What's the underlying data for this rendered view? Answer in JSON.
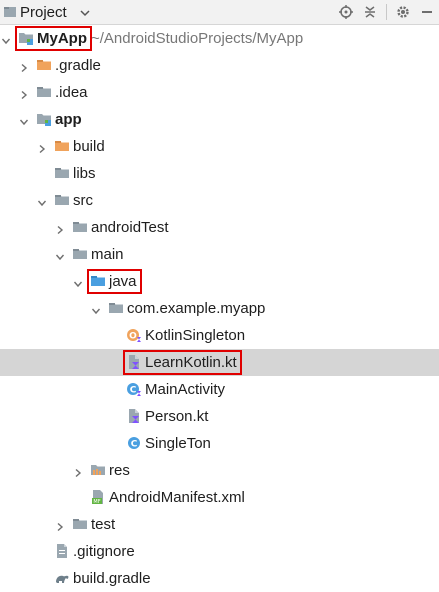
{
  "toolbar": {
    "title": "Project",
    "actions": [
      {
        "name": "locate-icon"
      },
      {
        "name": "collapse-all-icon"
      },
      {
        "name": "gear-icon"
      },
      {
        "name": "hide-icon"
      }
    ]
  },
  "tree": [
    {
      "label": "MyApp",
      "path": "~/AndroidStudioProjects/MyApp",
      "icon": "module-folder-icon",
      "arrow": "down",
      "bold": true,
      "highlight": true
    },
    {
      "label": ".gradle",
      "icon": "folder-orange-icon",
      "arrow": "right"
    },
    {
      "label": ".idea",
      "icon": "folder-gray-icon",
      "arrow": "right"
    },
    {
      "label": "app",
      "icon": "module-folder-icon",
      "arrow": "down",
      "bold": true
    },
    {
      "label": "build",
      "icon": "folder-orange-icon",
      "arrow": "right"
    },
    {
      "label": "libs",
      "icon": "folder-gray-icon",
      "arrow": "none"
    },
    {
      "label": "src",
      "icon": "folder-gray-icon",
      "arrow": "down"
    },
    {
      "label": "androidTest",
      "icon": "folder-gray-icon",
      "arrow": "right"
    },
    {
      "label": "main",
      "icon": "folder-gray-icon",
      "arrow": "down"
    },
    {
      "label": "java",
      "icon": "folder-blue-icon",
      "arrow": "down",
      "highlight": true
    },
    {
      "label": "com.example.myapp",
      "icon": "folder-gray-icon",
      "arrow": "down"
    },
    {
      "label": "KotlinSingleton",
      "icon": "kotlin-object-icon",
      "arrow": "none"
    },
    {
      "label": "LearnKotlin.kt",
      "icon": "kotlin-file-icon",
      "arrow": "none",
      "selected": true,
      "highlight": true
    },
    {
      "label": "MainActivity",
      "icon": "kotlin-class-icon",
      "arrow": "none"
    },
    {
      "label": "Person.kt",
      "icon": "kotlin-file-icon",
      "arrow": "none"
    },
    {
      "label": "SingleTon",
      "icon": "class-icon",
      "arrow": "none"
    },
    {
      "label": "res",
      "icon": "res-folder-icon",
      "arrow": "right"
    },
    {
      "label": "AndroidManifest.xml",
      "icon": "manifest-icon",
      "arrow": "none"
    },
    {
      "label": "test",
      "icon": "folder-gray-icon",
      "arrow": "right"
    },
    {
      "label": ".gitignore",
      "icon": "gitignore-icon",
      "arrow": "none"
    },
    {
      "label": "build.gradle",
      "icon": "gradle-icon",
      "arrow": "none"
    }
  ],
  "colors": {
    "selection": "#d5d5d5",
    "highlight_border": "#e00000",
    "folder_orange": "#f0a35c",
    "folder_gray": "#9aa7b0",
    "folder_blue": "#4a9fe0"
  }
}
